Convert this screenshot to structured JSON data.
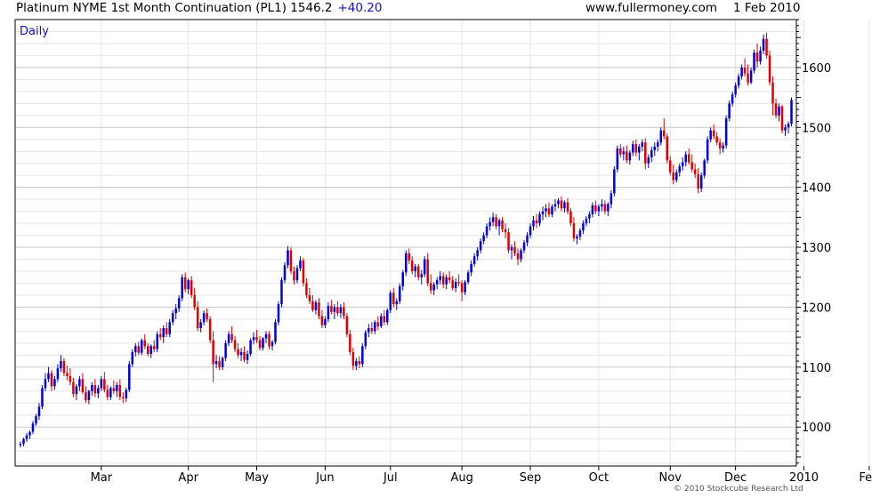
{
  "header": {
    "title": "Platinum NYME 1st Month Continuation (PL1) 1546.2",
    "change": "+40.20",
    "site": "www.fullermoney.com",
    "date": "1 Feb 2010"
  },
  "footer": {
    "copyright": "© 2010 Stockcube Research Ltd"
  },
  "chart_data": {
    "type": "candlestick",
    "label": "Daily",
    "ylim": [
      935,
      1680
    ],
    "yticks": [
      1000,
      1100,
      1200,
      1300,
      1400,
      1500,
      1600
    ],
    "xlabels": [
      {
        "label": "Mar",
        "day": 26
      },
      {
        "label": "Apr",
        "day": 54
      },
      {
        "label": "May",
        "day": 76
      },
      {
        "label": "Jun",
        "day": 98
      },
      {
        "label": "Jul",
        "day": 119
      },
      {
        "label": "Aug",
        "day": 142
      },
      {
        "label": "Sep",
        "day": 164
      },
      {
        "label": "Oct",
        "day": 186
      },
      {
        "label": "Nov",
        "day": 209
      },
      {
        "label": "Dec",
        "day": 230
      },
      {
        "label": "2010",
        "day": 252
      },
      {
        "label": "Feb",
        "day": 273
      }
    ],
    "colors": {
      "up": "#0000e0",
      "down": "#e00000",
      "grid": "#c8c8c8",
      "minorGrid": "#e6e6e6",
      "label": "#1010c8"
    },
    "ohlc": [
      [
        970,
        976,
        966,
        972
      ],
      [
        972,
        982,
        968,
        980
      ],
      [
        980,
        990,
        975,
        986
      ],
      [
        986,
        994,
        980,
        992
      ],
      [
        992,
        1010,
        988,
        1006
      ],
      [
        1006,
        1022,
        1002,
        1018
      ],
      [
        1018,
        1040,
        1012,
        1034
      ],
      [
        1034,
        1070,
        1030,
        1065
      ],
      [
        1065,
        1090,
        1060,
        1080
      ],
      [
        1080,
        1100,
        1075,
        1090
      ],
      [
        1090,
        1095,
        1060,
        1068
      ],
      [
        1068,
        1085,
        1062,
        1080
      ],
      [
        1080,
        1105,
        1075,
        1098
      ],
      [
        1098,
        1120,
        1092,
        1110
      ],
      [
        1110,
        1115,
        1085,
        1090
      ],
      [
        1090,
        1102,
        1078,
        1085
      ],
      [
        1085,
        1098,
        1070,
        1075
      ],
      [
        1075,
        1082,
        1050,
        1055
      ],
      [
        1055,
        1072,
        1045,
        1068
      ],
      [
        1068,
        1085,
        1060,
        1080
      ],
      [
        1080,
        1090,
        1055,
        1058
      ],
      [
        1058,
        1068,
        1040,
        1045
      ],
      [
        1045,
        1062,
        1038,
        1060
      ],
      [
        1060,
        1075,
        1052,
        1070
      ],
      [
        1070,
        1080,
        1050,
        1056
      ],
      [
        1056,
        1070,
        1048,
        1065
      ],
      [
        1065,
        1085,
        1060,
        1080
      ],
      [
        1080,
        1092,
        1058,
        1062
      ],
      [
        1062,
        1070,
        1045,
        1050
      ],
      [
        1050,
        1068,
        1045,
        1065
      ],
      [
        1065,
        1078,
        1055,
        1060
      ],
      [
        1060,
        1075,
        1050,
        1070
      ],
      [
        1070,
        1080,
        1045,
        1050
      ],
      [
        1050,
        1058,
        1040,
        1048
      ],
      [
        1048,
        1066,
        1042,
        1062
      ],
      [
        1062,
        1110,
        1058,
        1105
      ],
      [
        1105,
        1130,
        1100,
        1125
      ],
      [
        1125,
        1140,
        1118,
        1135
      ],
      [
        1135,
        1142,
        1120,
        1124
      ],
      [
        1124,
        1148,
        1120,
        1145
      ],
      [
        1145,
        1155,
        1130,
        1135
      ],
      [
        1135,
        1140,
        1118,
        1122
      ],
      [
        1122,
        1138,
        1115,
        1135
      ],
      [
        1135,
        1145,
        1125,
        1130
      ],
      [
        1130,
        1160,
        1125,
        1155
      ],
      [
        1155,
        1165,
        1145,
        1150
      ],
      [
        1150,
        1170,
        1140,
        1165
      ],
      [
        1165,
        1175,
        1150,
        1155
      ],
      [
        1155,
        1180,
        1150,
        1175
      ],
      [
        1175,
        1195,
        1170,
        1190
      ],
      [
        1190,
        1205,
        1180,
        1198
      ],
      [
        1198,
        1220,
        1192,
        1215
      ],
      [
        1215,
        1255,
        1210,
        1250
      ],
      [
        1250,
        1258,
        1225,
        1230
      ],
      [
        1230,
        1248,
        1222,
        1245
      ],
      [
        1245,
        1252,
        1215,
        1220
      ],
      [
        1220,
        1232,
        1195,
        1200
      ],
      [
        1200,
        1210,
        1160,
        1165
      ],
      [
        1165,
        1180,
        1158,
        1175
      ],
      [
        1175,
        1195,
        1170,
        1190
      ],
      [
        1190,
        1198,
        1175,
        1180
      ],
      [
        1180,
        1185,
        1140,
        1145
      ],
      [
        1145,
        1160,
        1075,
        1105
      ],
      [
        1105,
        1120,
        1098,
        1110
      ],
      [
        1110,
        1118,
        1095,
        1100
      ],
      [
        1100,
        1118,
        1095,
        1115
      ],
      [
        1115,
        1145,
        1110,
        1140
      ],
      [
        1140,
        1160,
        1135,
        1155
      ],
      [
        1155,
        1168,
        1140,
        1145
      ],
      [
        1145,
        1152,
        1125,
        1130
      ],
      [
        1130,
        1140,
        1115,
        1120
      ],
      [
        1120,
        1132,
        1110,
        1125
      ],
      [
        1125,
        1135,
        1108,
        1112
      ],
      [
        1112,
        1128,
        1105,
        1122
      ],
      [
        1122,
        1148,
        1118,
        1145
      ],
      [
        1145,
        1158,
        1138,
        1150
      ],
      [
        1150,
        1162,
        1140,
        1145
      ],
      [
        1145,
        1152,
        1128,
        1132
      ],
      [
        1132,
        1150,
        1128,
        1148
      ],
      [
        1148,
        1160,
        1140,
        1155
      ],
      [
        1155,
        1160,
        1130,
        1135
      ],
      [
        1135,
        1145,
        1128,
        1142
      ],
      [
        1142,
        1180,
        1138,
        1175
      ],
      [
        1175,
        1210,
        1170,
        1205
      ],
      [
        1205,
        1250,
        1200,
        1245
      ],
      [
        1245,
        1275,
        1240,
        1270
      ],
      [
        1270,
        1302,
        1265,
        1295
      ],
      [
        1295,
        1300,
        1255,
        1260
      ],
      [
        1260,
        1268,
        1238,
        1245
      ],
      [
        1245,
        1270,
        1240,
        1265
      ],
      [
        1265,
        1285,
        1260,
        1278
      ],
      [
        1278,
        1282,
        1235,
        1240
      ],
      [
        1240,
        1248,
        1215,
        1220
      ],
      [
        1220,
        1232,
        1205,
        1210
      ],
      [
        1210,
        1220,
        1192,
        1195
      ],
      [
        1195,
        1212,
        1188,
        1208
      ],
      [
        1208,
        1215,
        1180,
        1185
      ],
      [
        1185,
        1195,
        1165,
        1170
      ],
      [
        1170,
        1185,
        1165,
        1180
      ],
      [
        1180,
        1208,
        1175,
        1202
      ],
      [
        1202,
        1212,
        1188,
        1192
      ],
      [
        1192,
        1205,
        1180,
        1200
      ],
      [
        1200,
        1210,
        1185,
        1190
      ],
      [
        1190,
        1205,
        1182,
        1200
      ],
      [
        1200,
        1208,
        1180,
        1185
      ],
      [
        1185,
        1190,
        1150,
        1155
      ],
      [
        1155,
        1162,
        1120,
        1125
      ],
      [
        1125,
        1132,
        1095,
        1102
      ],
      [
        1102,
        1115,
        1095,
        1110
      ],
      [
        1110,
        1118,
        1098,
        1105
      ],
      [
        1105,
        1140,
        1100,
        1135
      ],
      [
        1135,
        1162,
        1130,
        1158
      ],
      [
        1158,
        1172,
        1150,
        1165
      ],
      [
        1165,
        1175,
        1155,
        1160
      ],
      [
        1160,
        1178,
        1155,
        1175
      ],
      [
        1175,
        1185,
        1162,
        1168
      ],
      [
        1168,
        1190,
        1165,
        1185
      ],
      [
        1185,
        1195,
        1170,
        1175
      ],
      [
        1175,
        1198,
        1170,
        1195
      ],
      [
        1195,
        1228,
        1190,
        1224
      ],
      [
        1224,
        1232,
        1200,
        1205
      ],
      [
        1205,
        1215,
        1195,
        1210
      ],
      [
        1210,
        1240,
        1205,
        1235
      ],
      [
        1235,
        1262,
        1228,
        1258
      ],
      [
        1258,
        1295,
        1252,
        1290
      ],
      [
        1290,
        1298,
        1272,
        1278
      ],
      [
        1278,
        1285,
        1255,
        1260
      ],
      [
        1260,
        1272,
        1250,
        1268
      ],
      [
        1268,
        1272,
        1245,
        1250
      ],
      [
        1250,
        1262,
        1238,
        1255
      ],
      [
        1255,
        1285,
        1250,
        1280
      ],
      [
        1280,
        1290,
        1235,
        1240
      ],
      [
        1240,
        1255,
        1222,
        1228
      ],
      [
        1228,
        1242,
        1220,
        1238
      ],
      [
        1238,
        1250,
        1230,
        1245
      ],
      [
        1245,
        1260,
        1238,
        1252
      ],
      [
        1252,
        1258,
        1232,
        1238
      ],
      [
        1238,
        1255,
        1230,
        1250
      ],
      [
        1250,
        1260,
        1240,
        1245
      ],
      [
        1245,
        1252,
        1228,
        1232
      ],
      [
        1232,
        1248,
        1225,
        1242
      ],
      [
        1242,
        1255,
        1235,
        1240
      ],
      [
        1240,
        1245,
        1210,
        1225
      ],
      [
        1225,
        1245,
        1220,
        1242
      ],
      [
        1242,
        1262,
        1238,
        1258
      ],
      [
        1258,
        1278,
        1252,
        1272
      ],
      [
        1272,
        1290,
        1268,
        1285
      ],
      [
        1285,
        1300,
        1278,
        1295
      ],
      [
        1295,
        1315,
        1290,
        1310
      ],
      [
        1310,
        1325,
        1305,
        1320
      ],
      [
        1320,
        1340,
        1315,
        1335
      ],
      [
        1335,
        1350,
        1328,
        1342
      ],
      [
        1342,
        1358,
        1335,
        1350
      ],
      [
        1350,
        1355,
        1330,
        1335
      ],
      [
        1335,
        1348,
        1320,
        1345
      ],
      [
        1345,
        1350,
        1325,
        1330
      ],
      [
        1330,
        1340,
        1315,
        1325
      ],
      [
        1325,
        1332,
        1290,
        1295
      ],
      [
        1295,
        1305,
        1280,
        1300
      ],
      [
        1300,
        1310,
        1285,
        1290
      ],
      [
        1290,
        1298,
        1270,
        1280
      ],
      [
        1280,
        1298,
        1275,
        1295
      ],
      [
        1295,
        1312,
        1290,
        1308
      ],
      [
        1308,
        1325,
        1302,
        1320
      ],
      [
        1320,
        1340,
        1315,
        1335
      ],
      [
        1335,
        1352,
        1328,
        1345
      ],
      [
        1345,
        1355,
        1332,
        1340
      ],
      [
        1340,
        1360,
        1335,
        1355
      ],
      [
        1355,
        1368,
        1345,
        1360
      ],
      [
        1360,
        1372,
        1350,
        1365
      ],
      [
        1365,
        1375,
        1350,
        1355
      ],
      [
        1355,
        1372,
        1350,
        1368
      ],
      [
        1368,
        1380,
        1360,
        1372
      ],
      [
        1372,
        1382,
        1365,
        1378
      ],
      [
        1378,
        1385,
        1360,
        1365
      ],
      [
        1365,
        1378,
        1358,
        1375
      ],
      [
        1375,
        1382,
        1355,
        1360
      ],
      [
        1360,
        1365,
        1335,
        1340
      ],
      [
        1340,
        1350,
        1310,
        1315
      ],
      [
        1315,
        1322,
        1305,
        1318
      ],
      [
        1318,
        1332,
        1312,
        1328
      ],
      [
        1328,
        1345,
        1322,
        1340
      ],
      [
        1340,
        1352,
        1335,
        1348
      ],
      [
        1348,
        1360,
        1340,
        1355
      ],
      [
        1355,
        1375,
        1350,
        1370
      ],
      [
        1370,
        1378,
        1355,
        1360
      ],
      [
        1360,
        1372,
        1352,
        1368
      ],
      [
        1368,
        1380,
        1360,
        1372
      ],
      [
        1372,
        1378,
        1355,
        1360
      ],
      [
        1360,
        1375,
        1352,
        1372
      ],
      [
        1372,
        1395,
        1365,
        1390
      ],
      [
        1390,
        1435,
        1385,
        1430
      ],
      [
        1430,
        1470,
        1425,
        1465
      ],
      [
        1465,
        1472,
        1450,
        1455
      ],
      [
        1455,
        1468,
        1445,
        1460
      ],
      [
        1460,
        1470,
        1440,
        1445
      ],
      [
        1445,
        1462,
        1438,
        1458
      ],
      [
        1458,
        1478,
        1452,
        1472
      ],
      [
        1472,
        1480,
        1452,
        1458
      ],
      [
        1458,
        1472,
        1445,
        1468
      ],
      [
        1468,
        1480,
        1460,
        1475
      ],
      [
        1475,
        1482,
        1430,
        1440
      ],
      [
        1440,
        1455,
        1432,
        1450
      ],
      [
        1450,
        1468,
        1442,
        1462
      ],
      [
        1462,
        1475,
        1452,
        1468
      ],
      [
        1468,
        1480,
        1460,
        1475
      ],
      [
        1475,
        1500,
        1470,
        1495
      ],
      [
        1495,
        1515,
        1480,
        1485
      ],
      [
        1485,
        1490,
        1440,
        1445
      ],
      [
        1445,
        1452,
        1420,
        1425
      ],
      [
        1425,
        1438,
        1405,
        1412
      ],
      [
        1412,
        1430,
        1408,
        1425
      ],
      [
        1425,
        1440,
        1418,
        1435
      ],
      [
        1435,
        1450,
        1428,
        1442
      ],
      [
        1442,
        1460,
        1435,
        1455
      ],
      [
        1455,
        1465,
        1438,
        1442
      ],
      [
        1442,
        1455,
        1425,
        1430
      ],
      [
        1430,
        1440,
        1415,
        1422
      ],
      [
        1422,
        1432,
        1390,
        1398
      ],
      [
        1398,
        1425,
        1392,
        1420
      ],
      [
        1420,
        1448,
        1415,
        1445
      ],
      [
        1445,
        1485,
        1440,
        1480
      ],
      [
        1480,
        1500,
        1475,
        1495
      ],
      [
        1495,
        1505,
        1480,
        1485
      ],
      [
        1485,
        1492,
        1470,
        1475
      ],
      [
        1475,
        1482,
        1455,
        1465
      ],
      [
        1465,
        1475,
        1458,
        1470
      ],
      [
        1470,
        1520,
        1465,
        1515
      ],
      [
        1515,
        1545,
        1510,
        1540
      ],
      [
        1540,
        1560,
        1535,
        1555
      ],
      [
        1555,
        1575,
        1550,
        1570
      ],
      [
        1570,
        1590,
        1565,
        1585
      ],
      [
        1585,
        1605,
        1580,
        1600
      ],
      [
        1600,
        1615,
        1585,
        1590
      ],
      [
        1590,
        1605,
        1570,
        1575
      ],
      [
        1575,
        1600,
        1572,
        1595
      ],
      [
        1595,
        1630,
        1590,
        1625
      ],
      [
        1625,
        1640,
        1600,
        1610
      ],
      [
        1610,
        1635,
        1605,
        1628
      ],
      [
        1628,
        1655,
        1622,
        1648
      ],
      [
        1648,
        1658,
        1615,
        1620
      ],
      [
        1620,
        1628,
        1570,
        1575
      ],
      [
        1575,
        1585,
        1520,
        1540
      ],
      [
        1540,
        1548,
        1515,
        1520
      ],
      [
        1520,
        1540,
        1510,
        1535
      ],
      [
        1535,
        1538,
        1490,
        1495
      ],
      [
        1495,
        1505,
        1486,
        1500
      ],
      [
        1500,
        1510,
        1490,
        1506
      ],
      [
        1506,
        1550,
        1502,
        1546
      ]
    ]
  }
}
